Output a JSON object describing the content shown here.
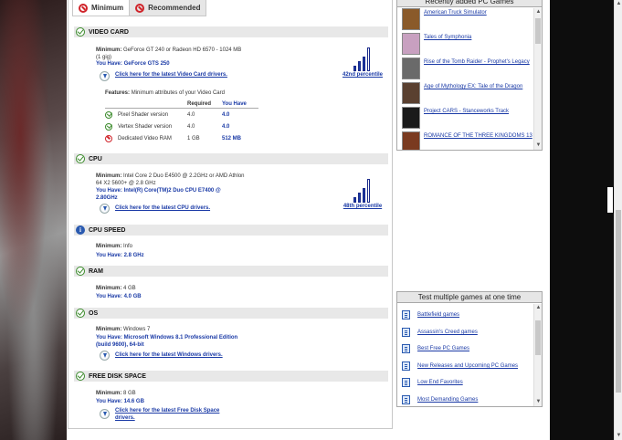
{
  "tabs": [
    {
      "label": "Minimum",
      "active": true
    },
    {
      "label": "Recommended",
      "active": false
    }
  ],
  "video_card": {
    "header": "VIDEO CARD",
    "minimum_label": "Minimum:",
    "minimum_value": "GeForce GT 240 or Radeon HD 6570 - 1024 MB",
    "minimum_value2": "(1 gig)",
    "you_have": "You Have: GeForce GTS 250",
    "driver_link": "Click here for the latest Video Card drivers.",
    "percentile": "42nd percentile",
    "percentile_value": 42,
    "features_label": "Features:",
    "features_value": "Minimum attributes of your Video Card",
    "table": {
      "col_required": "Required",
      "col_you_have": "You Have",
      "rows": [
        {
          "name": "Pixel Shader version",
          "required": "4.0",
          "have": "4.0",
          "ok": true
        },
        {
          "name": "Vertex Shader version",
          "required": "4.0",
          "have": "4.0",
          "ok": true
        },
        {
          "name": "Dedicated Video RAM",
          "required": "1 GB",
          "have": "512 MB",
          "ok": false
        }
      ]
    }
  },
  "cpu": {
    "header": "CPU",
    "minimum_label": "Minimum:",
    "minimum_value": "Intel Core 2 Duo E4500 @ 2.2GHz or AMD Athlon",
    "minimum_value2": "64 X2 5600+ @ 2.8 GHz",
    "you_have": "You Have: Intel(R) Core(TM)2 Duo CPU E7400 @",
    "you_have2": "2.80GHz",
    "driver_link": "Click here for the latest CPU drivers.",
    "percentile": "48th percentile",
    "percentile_value": 48
  },
  "cpu_speed": {
    "header": "CPU SPEED",
    "minimum_label": "Minimum:",
    "minimum_value": "Info",
    "you_have": "You Have: 2.8 GHz"
  },
  "ram": {
    "header": "RAM",
    "minimum_label": "Minimum:",
    "minimum_value": "4 GB",
    "you_have": "You Have: 4.0 GB"
  },
  "os": {
    "header": "OS",
    "minimum_label": "Minimum:",
    "minimum_value": "Windows 7",
    "you_have": "You Have: Microsoft Windows 8.1 Professional Edition",
    "you_have2": "(build 9600), 64-bit",
    "driver_link": "Click here for the latest Windows drivers."
  },
  "disk": {
    "header": "FREE DISK SPACE",
    "minimum_label": "Minimum:",
    "minimum_value": "8 GB",
    "you_have": "You Have: 14.6 GB",
    "driver_link": "Click here for the latest Free Disk Space",
    "driver_link2": "drivers."
  },
  "recent": {
    "title": "Recently added PC Games",
    "items": [
      {
        "name": "American Truck Simulator",
        "color": "#8a5a2a"
      },
      {
        "name": "Tales of Symphonia",
        "color": "#c8a0c0"
      },
      {
        "name": "Rise of the Tomb Raider - Prophet's Legacy",
        "color": "#6a6a6a"
      },
      {
        "name": "Age of Mythology EX: Tale of the Dragon",
        "color": "#5a4030"
      },
      {
        "name": "Project CARS - Stanceworks Track",
        "color": "#1a1a1a"
      },
      {
        "name": "ROMANCE OF THE THREE KINGDOMS 13",
        "color": "#7a3a20"
      }
    ]
  },
  "multi": {
    "title": "Test multiple games at one time",
    "items": [
      "Battlefield games",
      "Assassin's Creed games",
      "Best Free PC Games",
      "New Releases and Upcoming PC Games",
      "Low End Favorites",
      "Most Demanding Games"
    ]
  }
}
